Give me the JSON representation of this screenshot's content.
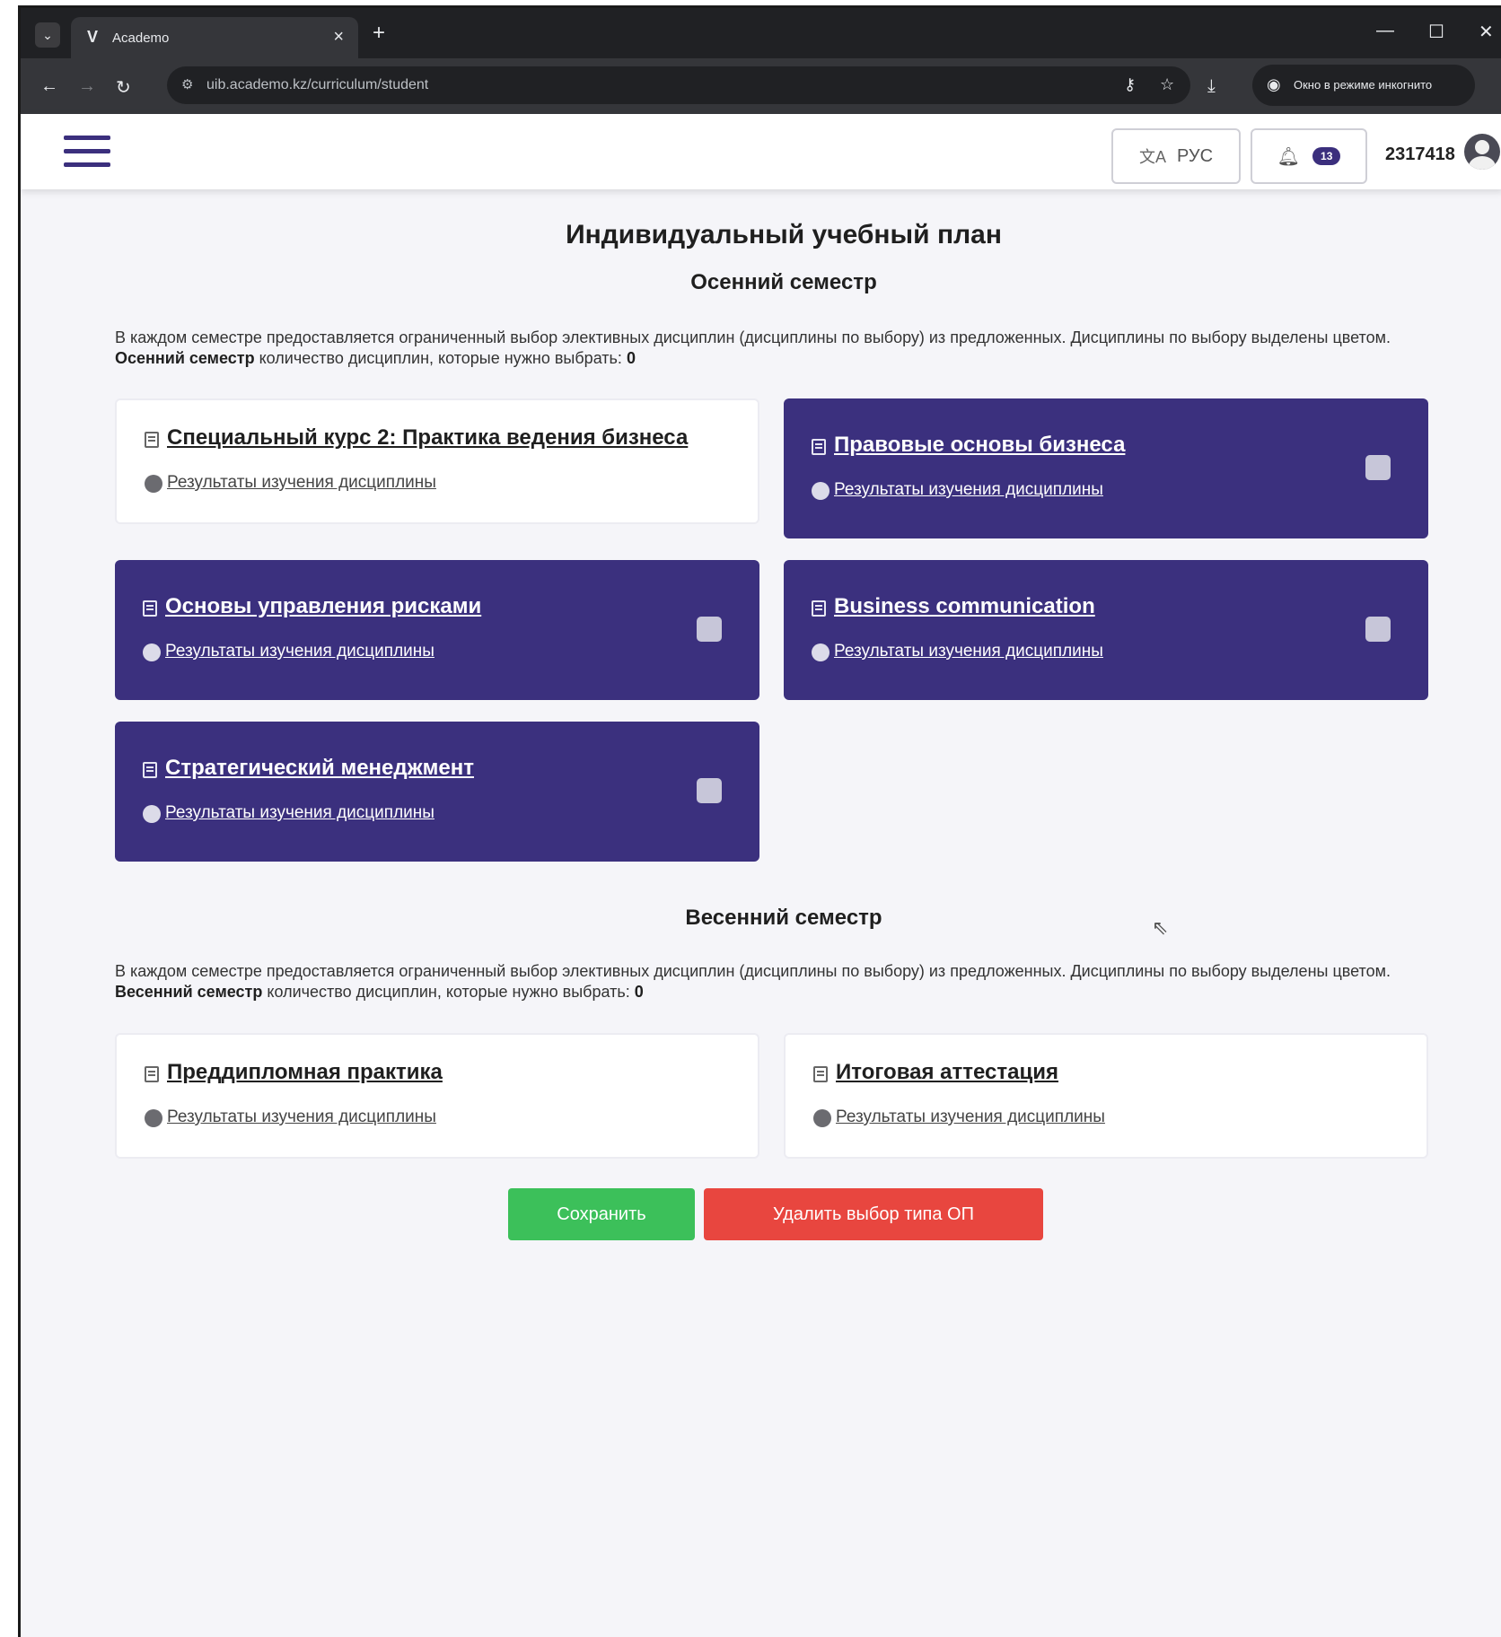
{
  "browser": {
    "tab_title": "Academo",
    "tab_favicon": "V",
    "url": "uib.academo.kz/curriculum/student",
    "incognito_label": "Окно в режиме инкогнито",
    "icons": [
      "menu-icon",
      "close-icon",
      "plus-icon",
      "minimize-icon",
      "maximize-icon",
      "back-icon",
      "forward-icon",
      "reload-icon",
      "site-settings-icon",
      "password-key-icon",
      "star-icon",
      "download-icon",
      "incognito-icon"
    ]
  },
  "header": {
    "language_label": "РУС",
    "notification_count": "13",
    "user_id": "2317418"
  },
  "page": {
    "title": "Индивидуальный учебный план"
  },
  "autumn": {
    "title": "Осенний семестр",
    "desc_prefix": "В каждом семестре предоставляется ограниченный выбор элективных дисциплин (дисциплины по выбору) из предложенных. Дисциплины по выбору выделены цветом.",
    "desc_bold": "Осенний семестр",
    "desc_suffix": "количество дисциплин, которые нужно выбрать:",
    "count": "0",
    "cards": [
      {
        "title": "Специальный курс 2: Практика ведения бизнеса",
        "link": "Результаты изучения дисциплины"
      },
      {
        "title": "Правовые основы бизнеса",
        "link": "Результаты изучения дисциплины"
      },
      {
        "title": "Основы управления рисками",
        "link": "Результаты изучения дисциплины"
      },
      {
        "title": "Business communication",
        "link": "Результаты изучения дисциплины"
      },
      {
        "title": "Стратегический менеджмент",
        "link": "Результаты изучения дисциплины"
      }
    ]
  },
  "spring": {
    "title": "Весенний семестр",
    "desc_prefix": "В каждом семестре предоставляется ограниченный выбор элективных дисциплин (дисциплины по выбору) из предложенных. Дисциплины по выбору выделены цветом.",
    "desc_bold": "Весенний семестр",
    "desc_suffix": "количество дисциплин, которые нужно выбрать:",
    "count": "0",
    "cards": [
      {
        "title": "Преддипломная практика",
        "link": "Результаты изучения дисциплины"
      },
      {
        "title": "Итоговая аттестация",
        "link": "Результаты изучения дисциплины"
      }
    ]
  },
  "actions": {
    "save_label": "Сохранить",
    "delete_label": "Удалить выбор типа ОП"
  },
  "colors": {
    "elective_card": "#3b307e",
    "save": "#3cc05a",
    "delete": "#e8463f"
  }
}
